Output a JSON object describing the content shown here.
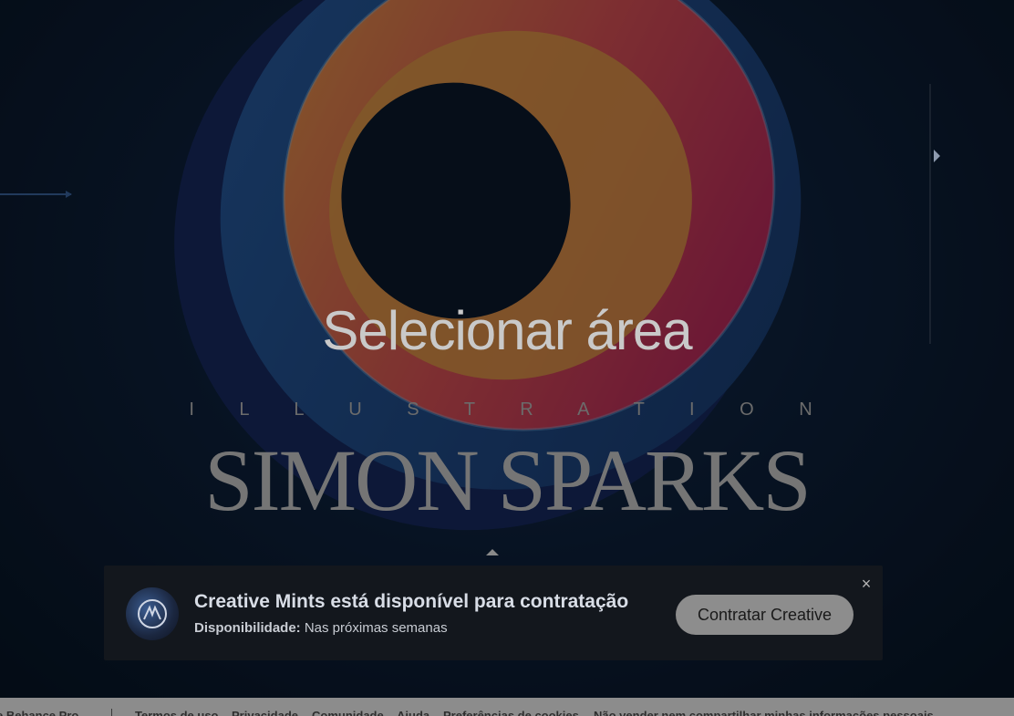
{
  "overlay": {
    "select_label": "Selecionar área"
  },
  "artwork": {
    "subtitle": "I L L U S T R A T I O N",
    "title": "SIMON SPARKS"
  },
  "hire_card": {
    "title": "Creative Mints está disponível para contratação",
    "availability_label": "Disponibilidade:",
    "availability_value": "Nas próximas semanas",
    "button_label": "Contratar Creative",
    "close_label": "×"
  },
  "footer": {
    "brand": "e Behance Pro",
    "links": [
      "Termos de uso",
      "Privacidade",
      "Comunidade",
      "Ajuda",
      "Preferências de cookies",
      "Não vender nem compartilhar minhas informações pessoais"
    ]
  },
  "colors": {
    "background": "#0b1a2e",
    "ring_blue": "#2f6fb3",
    "ring_orange": "#e8923d",
    "ring_pink": "#d7356f",
    "button": "#8d8d8d"
  }
}
